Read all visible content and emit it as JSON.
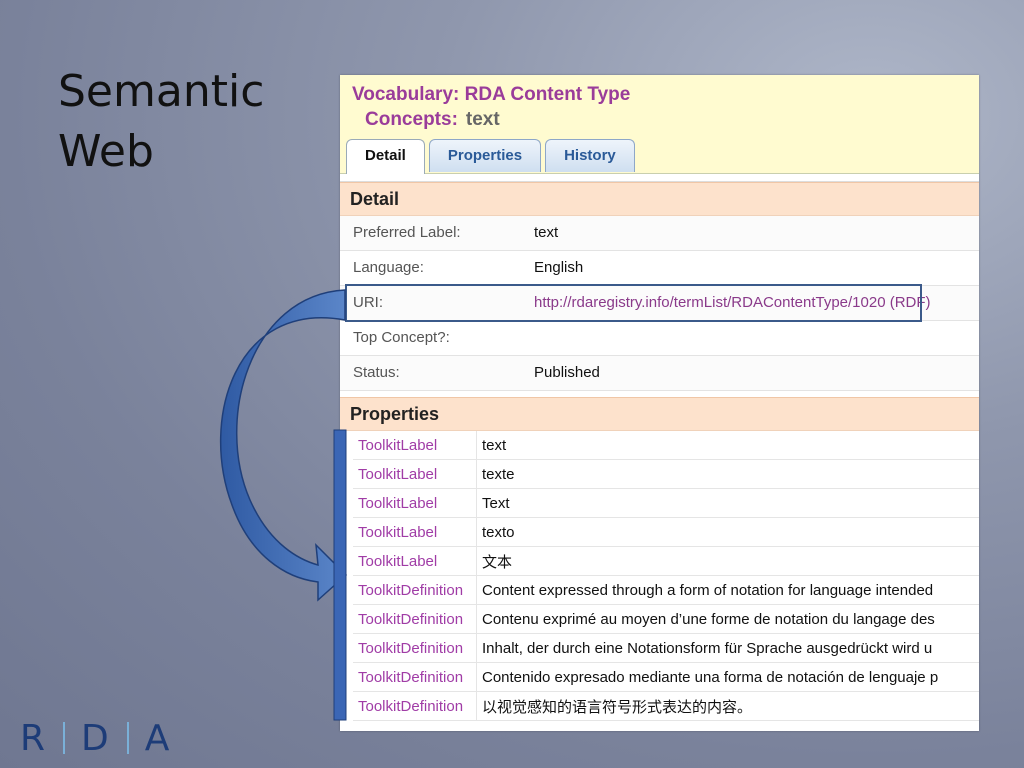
{
  "slide": {
    "title_line1": "Semantic",
    "title_line2": "Web"
  },
  "header": {
    "vocab_label": "Vocabulary: RDA Content Type",
    "concepts_label": "Concepts:",
    "concepts_value": "text"
  },
  "tabs": [
    {
      "label": "Detail",
      "active": true
    },
    {
      "label": "Properties",
      "active": false
    },
    {
      "label": "History",
      "active": false
    }
  ],
  "detail": {
    "heading": "Detail",
    "rows": [
      {
        "label": "Preferred Label:",
        "value": "text"
      },
      {
        "label": "Language:",
        "value": "English"
      },
      {
        "label": "URI:",
        "value": "http://rdaregistry.info/termList/RDAContentType/1020",
        "extra": "(RDF)"
      },
      {
        "label": "Top Concept?:",
        "value": ""
      },
      {
        "label": "Status:",
        "value": "Published"
      }
    ]
  },
  "properties": {
    "heading": "Properties",
    "rows": [
      {
        "name": "ToolkitLabel",
        "value": "text"
      },
      {
        "name": "ToolkitLabel",
        "value": "texte"
      },
      {
        "name": "ToolkitLabel",
        "value": "Text"
      },
      {
        "name": "ToolkitLabel",
        "value": "texto"
      },
      {
        "name": "ToolkitLabel",
        "value": "文本"
      },
      {
        "name": "ToolkitDefinition",
        "value": "Content expressed through a form of notation for language intended"
      },
      {
        "name": "ToolkitDefinition",
        "value": "Contenu exprimé au moyen d’une forme de notation du langage des"
      },
      {
        "name": "ToolkitDefinition",
        "value": "Inhalt, der durch eine Notationsform für Sprache ausgedrückt wird u"
      },
      {
        "name": "ToolkitDefinition",
        "value": "Contenido expresado mediante una forma de notación de lenguaje p"
      },
      {
        "name": "ToolkitDefinition",
        "value": "以视觉感知的语言符号形式表达的内容。"
      }
    ]
  },
  "logo": {
    "letters": [
      "R",
      "D",
      "A"
    ]
  },
  "colors": {
    "accent_purple": "#9a3c9a",
    "arrow_blue": "#3c68b0",
    "section_bg": "#fde2cc",
    "header_bg": "#fffbd0"
  }
}
